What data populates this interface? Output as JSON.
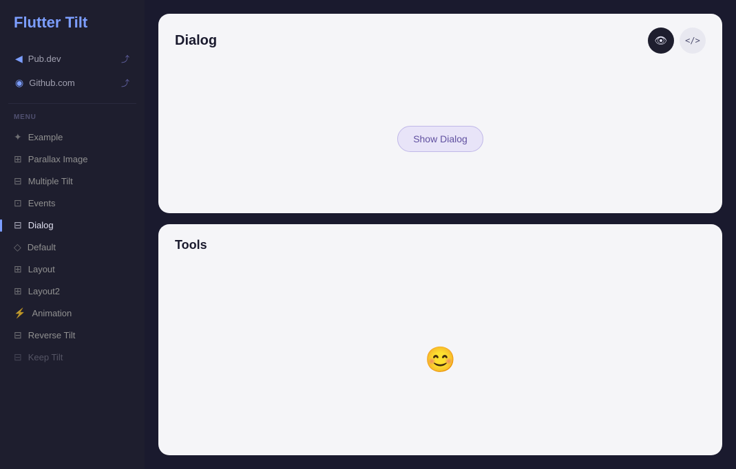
{
  "sidebar": {
    "logo": {
      "text_plain": "Flutter ",
      "text_accent": "Tilt"
    },
    "links": [
      {
        "icon": "◀",
        "label": "Pub.dev",
        "ext": "🔗"
      },
      {
        "icon": "◉",
        "label": "Github.com",
        "ext": "🔗"
      }
    ],
    "menu_label": "MENU",
    "menu_items": [
      {
        "icon": "✦",
        "label": "Example",
        "active": false,
        "dimmed": false
      },
      {
        "icon": "⊞",
        "label": "Parallax Image",
        "active": false,
        "dimmed": false
      },
      {
        "icon": "⊟",
        "label": "Multiple Tilt",
        "active": false,
        "dimmed": false
      },
      {
        "icon": "⊡",
        "label": "Events",
        "active": false,
        "dimmed": false
      },
      {
        "icon": "⊟",
        "label": "Dialog",
        "active": true,
        "dimmed": false
      },
      {
        "icon": "◇",
        "label": "Default",
        "active": false,
        "dimmed": false
      },
      {
        "icon": "⊞",
        "label": "Layout",
        "active": false,
        "dimmed": false
      },
      {
        "icon": "⊞",
        "label": "Layout2",
        "active": false,
        "dimmed": false
      },
      {
        "icon": "⚡",
        "label": "Animation",
        "active": false,
        "dimmed": false
      },
      {
        "icon": "⊟",
        "label": "Reverse Tilt",
        "active": false,
        "dimmed": false
      },
      {
        "icon": "⊟",
        "label": "Keep Tilt",
        "active": false,
        "dimmed": true
      }
    ]
  },
  "demo_card": {
    "title": "Dialog",
    "actions": {
      "preview_icon": "👁",
      "code_icon": "</>",
      "preview_label": "preview",
      "code_label": "code"
    },
    "show_dialog_button": "Show Dialog"
  },
  "tools_card": {
    "title": "Tools",
    "smiley": "😊"
  },
  "icons": {
    "pub_dev": "◀",
    "github": "◉",
    "external_link": "⤴",
    "eye": "●",
    "code": "</>"
  }
}
